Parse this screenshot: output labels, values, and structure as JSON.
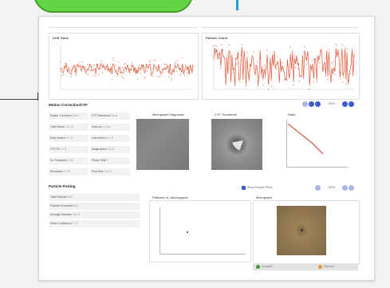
{
  "plots": {
    "left_title": "Drift Track",
    "right_title": "Particle Count"
  },
  "motion": {
    "title": "Motion Correction/CTF",
    "fields": [
      {
        "label": "Motion Correction",
        "value": "Done"
      },
      {
        "label": "CTF Estimation",
        "value": "Done"
      },
      {
        "label": "Total Motion",
        "value": "14.2 Å"
      },
      {
        "label": "Defocus",
        "value": "1.5 µm"
      },
      {
        "label": "Early Motion",
        "value": "9.1 Å"
      },
      {
        "label": "Late Motion",
        "value": "5.1 Å"
      },
      {
        "label": "CTF Fit",
        "value": "3.2 Å"
      },
      {
        "label": "Astigmatism",
        "value": "210 Å"
      },
      {
        "label": "Ice Thickness",
        "value": "1.05"
      },
      {
        "label": "Phase Shift",
        "value": "0"
      },
      {
        "label": "Resolution",
        "value": "4.0 Å"
      },
      {
        "label": "Pixel Size",
        "value": "0.83 Å"
      }
    ],
    "panels": [
      "Micrograph Diagnostic",
      "CTF Thumbnail",
      "Rank"
    ],
    "zoom": "100%"
  },
  "picking": {
    "title": "Particle Picking",
    "fields": [
      {
        "label": "Total Particles",
        "value": "842"
      },
      {
        "label": "Particles Extracted",
        "value": "820"
      },
      {
        "label": "Average Diameter",
        "value": "160 Å"
      },
      {
        "label": "Mean Confidence",
        "value": "0.71"
      }
    ],
    "scatter_title": "Particles vs. Micrographs",
    "image_title": "Micrograph",
    "checkbox_label": "Show Particle Picks",
    "zoom": "100%",
    "legend": [
      "Accepted",
      "Rejected"
    ]
  },
  "colors": {
    "accent": "#3c5bd0",
    "series": "#e0593a",
    "accepted": "#3b9a2e",
    "rejected": "#e79a2c"
  },
  "icons": [
    "zoom-in-icon",
    "zoom-out-icon",
    "reset-icon"
  ]
}
